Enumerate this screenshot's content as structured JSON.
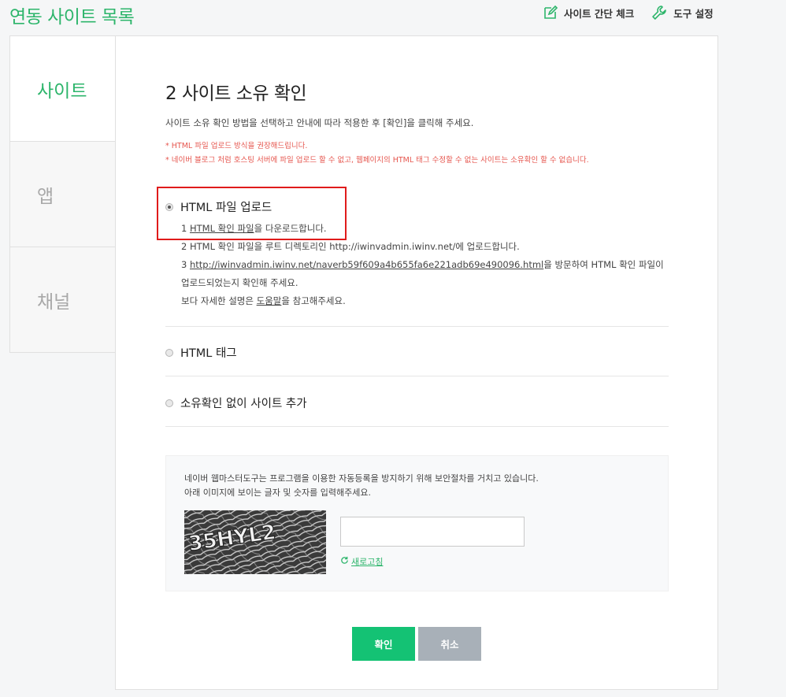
{
  "header": {
    "title": "연동 사이트 목록",
    "tools": [
      {
        "label": "사이트 간단 체크",
        "icon": "edit-icon"
      },
      {
        "label": "도구 설정",
        "icon": "wrench-icon"
      }
    ]
  },
  "side_tabs": [
    {
      "label": "사이트",
      "active": true
    },
    {
      "label": "앱",
      "active": false
    },
    {
      "label": "채널",
      "active": false
    }
  ],
  "panel": {
    "title": "2 사이트 소유 확인",
    "description": "사이트 소유 확인 방법을 선택하고 안내에 따라 적용한 후 [확인]을 클릭해 주세요.",
    "notes": [
      "* HTML 파일 업로드 방식을 권장해드립니다.",
      "* 네이버 블로그 처럼 호스팅 서버에 파일 업로드 할 수 없고, 웹페이지의 HTML 태그 수정할 수 없는 사이트는 소유확인 할 수 없습니다."
    ],
    "options": [
      {
        "label": "HTML 파일 업로드",
        "checked": true
      },
      {
        "label": "HTML 태그",
        "checked": false
      },
      {
        "label": "소유확인 없이 사이트 추가",
        "checked": false
      }
    ],
    "steps": {
      "step1_prefix": "1 ",
      "step1_link": "HTML 확인 파일",
      "step1_suffix": "을 다운로드합니다.",
      "step2": "2 HTML 확인 파일을 루트 디렉토리인 http://iwinvadmin.iwinv.net/에 업로드합니다.",
      "step3_prefix": "3 ",
      "step3_link": "http://iwinvadmin.iwinv.net/naverb59f609a4b655fa6e221adb69e490096.html",
      "step3_suffix": "을 방문하여 HTML 확인 파일이 업로드되었는지 확인해 주세요.",
      "step4_prefix": "보다 자세한 설명은 ",
      "step4_link": "도움말",
      "step4_suffix": "을 참고해주세요."
    },
    "captcha": {
      "line1": "네이버 웹마스터도구는 프로그램을 이용한 자동등록을 방지하기 위해 보안절차를 거치고 있습니다.",
      "line2": "아래 이미지에 보이는 글자 및 숫자를 입력해주세요.",
      "image_text": "35HYL2",
      "input_value": "",
      "refresh_label": "새로고침"
    },
    "buttons": {
      "ok": "확인",
      "cancel": "취소"
    }
  },
  "colors": {
    "accent": "#2db56b",
    "ok_button": "#14c274",
    "cancel_button": "#a8b0b8",
    "warning": "#e6574f",
    "highlight": "#e01b1b"
  }
}
